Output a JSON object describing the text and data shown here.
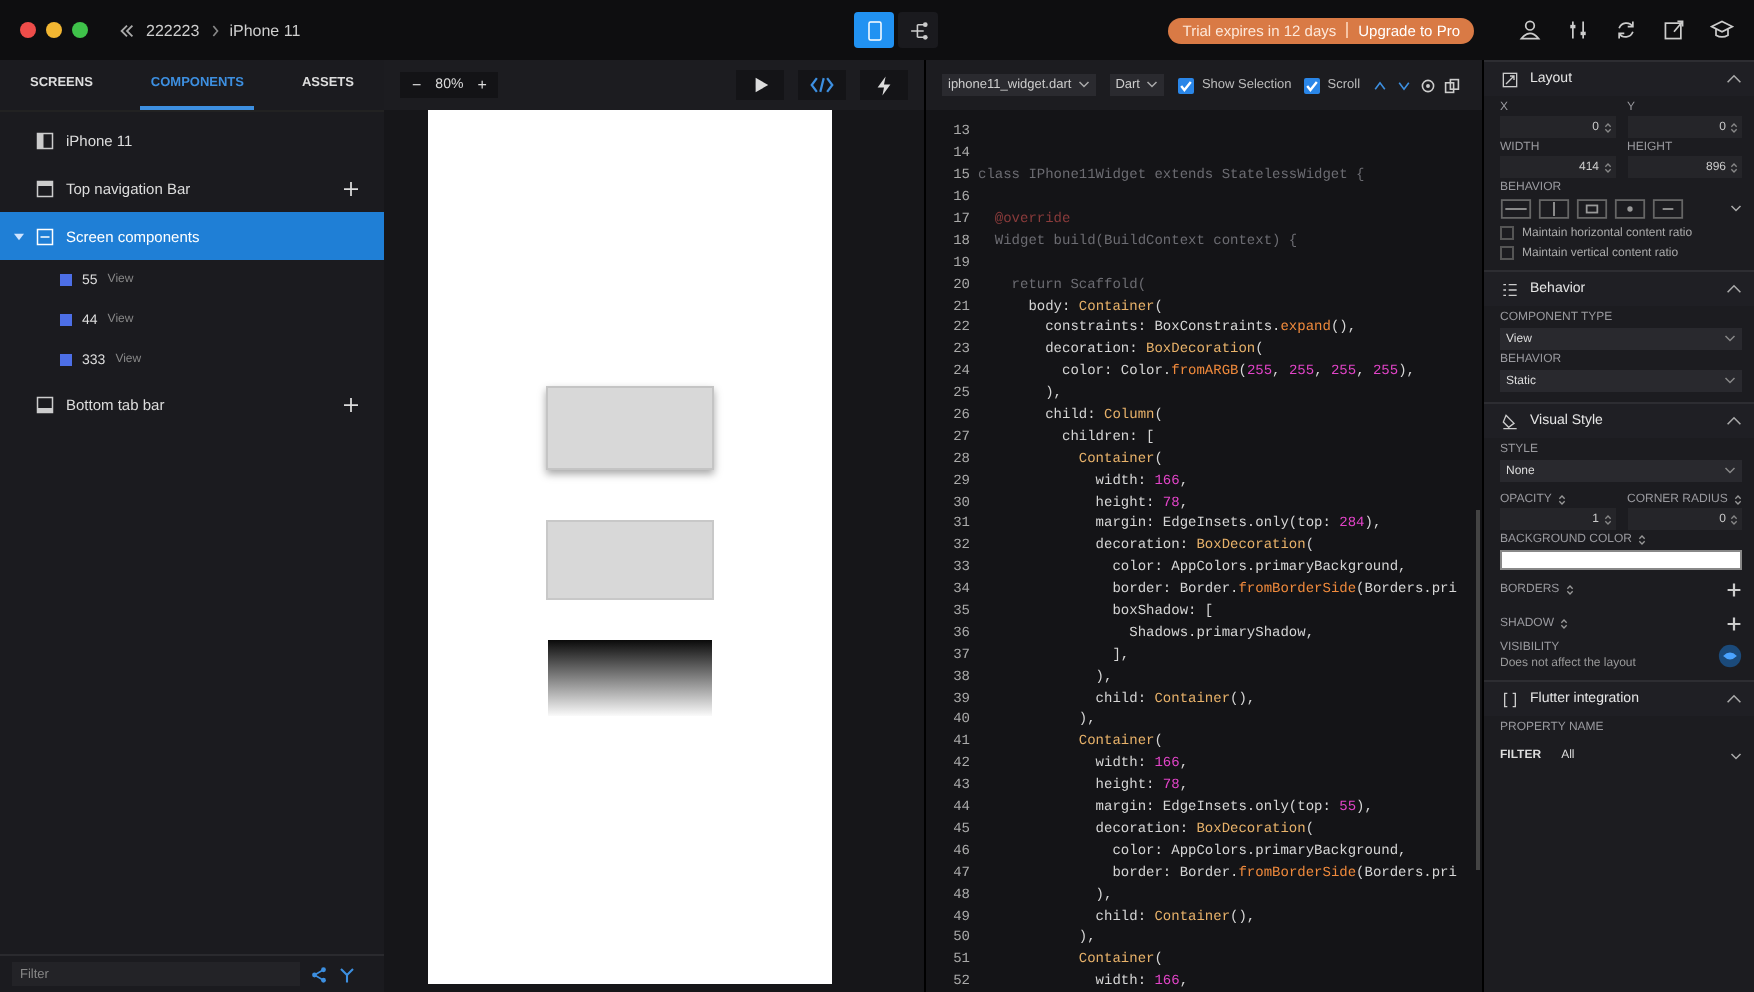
{
  "window": {
    "breadcrumb": [
      "222223",
      "iPhone 11"
    ]
  },
  "view_toggles": [
    {
      "kind": "device",
      "selected": true
    },
    {
      "kind": "tree",
      "selected": false
    }
  ],
  "trial": {
    "notice": "Trial expires in 12 days",
    "link": "Upgrade to Pro"
  },
  "sidebar": {
    "tabs": [
      {
        "label": "SCREENS",
        "selected": false
      },
      {
        "label": "COMPONENTS",
        "selected": true
      },
      {
        "label": "ASSETS",
        "selected": false
      }
    ],
    "tree": [
      {
        "kind": "screen",
        "label": "iPhone 11",
        "selected": false,
        "add": false
      },
      {
        "kind": "top-bar",
        "label": "Top navigation Bar",
        "selected": false,
        "add": true
      },
      {
        "kind": "group",
        "label": "Screen components",
        "selected": true,
        "add": false,
        "expanded": true,
        "children": [
          {
            "label": "55",
            "type": "View",
            "selected": false
          },
          {
            "label": "44",
            "type": "View",
            "selected": false
          },
          {
            "label": "333",
            "type": "View",
            "selected": false
          }
        ]
      },
      {
        "kind": "bottom-bar",
        "label": "Bottom tab bar",
        "selected": false,
        "add": true
      }
    ],
    "filter": {
      "placeholder": "Filter"
    }
  },
  "canvas": {
    "zoom_out": "−",
    "zoom": "80%",
    "zoom_in": "+",
    "tools": [
      {
        "kind": "play",
        "selected": false
      },
      {
        "kind": "code",
        "selected": true
      },
      {
        "kind": "bolt",
        "selected": false
      }
    ],
    "blocks": [
      {
        "kind": "shadow"
      },
      {
        "kind": "flat"
      },
      {
        "kind": "gradient"
      }
    ]
  },
  "code": {
    "file": "iphone11_widget.dart",
    "language": "Dart",
    "options": [
      {
        "label": "Show Selection",
        "checked": true
      },
      {
        "label": "Scroll",
        "checked": true
      }
    ],
    "lines": [
      {
        "n": "13"
      },
      {
        "n": "14"
      },
      {
        "n": "15",
        "tokens": [
          {
            "t": "class IPhone11Widget extends StatelessWidget {",
            "kind": "dim"
          }
        ]
      },
      {
        "n": "16"
      },
      {
        "n": "17",
        "tokens": [
          {
            "t": "  @override",
            "kind": "dimkw"
          }
        ]
      },
      {
        "n": "18",
        "tokens": [
          {
            "t": "  Widget build(BuildContext context) {",
            "kind": "dim"
          }
        ]
      },
      {
        "n": "19"
      },
      {
        "n": "20",
        "tokens": [
          {
            "t": "    return Scaffold(",
            "kind": "dim"
          }
        ]
      },
      {
        "n": "21",
        "tokens": [
          {
            "t": "      body: ",
            "kind": "p"
          },
          {
            "t": "Container",
            "kind": "type"
          },
          {
            "t": "(",
            "kind": "p"
          }
        ]
      },
      {
        "n": "22",
        "tokens": [
          {
            "t": "        constraints: BoxConstraints.",
            "kind": "p"
          },
          {
            "t": "expand",
            "kind": "fn"
          },
          {
            "t": "(),",
            "kind": "p"
          }
        ]
      },
      {
        "n": "23",
        "tokens": [
          {
            "t": "        decoration: ",
            "kind": "p"
          },
          {
            "t": "BoxDecoration",
            "kind": "type"
          },
          {
            "t": "(",
            "kind": "p"
          }
        ]
      },
      {
        "n": "24",
        "tokens": [
          {
            "t": "          color: Color.",
            "kind": "p"
          },
          {
            "t": "fromARGB",
            "kind": "fn"
          },
          {
            "t": "(",
            "kind": "p"
          },
          {
            "t": "255",
            "kind": "num"
          },
          {
            "t": ", ",
            "kind": "p"
          },
          {
            "t": "255",
            "kind": "num"
          },
          {
            "t": ", ",
            "kind": "p"
          },
          {
            "t": "255",
            "kind": "num"
          },
          {
            "t": ", ",
            "kind": "p"
          },
          {
            "t": "255",
            "kind": "num"
          },
          {
            "t": "),",
            "kind": "p"
          }
        ]
      },
      {
        "n": "25",
        "tokens": [
          {
            "t": "        ),",
            "kind": "p"
          }
        ]
      },
      {
        "n": "26",
        "tokens": [
          {
            "t": "        child: ",
            "kind": "p"
          },
          {
            "t": "Column",
            "kind": "type"
          },
          {
            "t": "(",
            "kind": "p"
          }
        ]
      },
      {
        "n": "27",
        "tokens": [
          {
            "t": "          children: [",
            "kind": "p"
          }
        ]
      },
      {
        "n": "28",
        "tokens": [
          {
            "t": "            Container",
            "kind": "type"
          },
          {
            "t": "(",
            "kind": "p"
          }
        ]
      },
      {
        "n": "29",
        "tokens": [
          {
            "t": "              width: ",
            "kind": "p"
          },
          {
            "t": "166",
            "kind": "num"
          },
          {
            "t": ",",
            "kind": "p"
          }
        ]
      },
      {
        "n": "30",
        "tokens": [
          {
            "t": "              height: ",
            "kind": "p"
          },
          {
            "t": "78",
            "kind": "num"
          },
          {
            "t": ",",
            "kind": "p"
          }
        ]
      },
      {
        "n": "31",
        "tokens": [
          {
            "t": "              margin: EdgeInsets.only(top: ",
            "kind": "p"
          },
          {
            "t": "284",
            "kind": "num"
          },
          {
            "t": "),",
            "kind": "p"
          }
        ]
      },
      {
        "n": "32",
        "tokens": [
          {
            "t": "              decoration: ",
            "kind": "p"
          },
          {
            "t": "BoxDecoration",
            "kind": "type"
          },
          {
            "t": "(",
            "kind": "p"
          }
        ]
      },
      {
        "n": "33",
        "tokens": [
          {
            "t": "                color: AppColors.primaryBackground,",
            "kind": "p"
          }
        ]
      },
      {
        "n": "34",
        "tokens": [
          {
            "t": "                border: Border.",
            "kind": "p"
          },
          {
            "t": "fromBorderSide",
            "kind": "fn"
          },
          {
            "t": "(Borders.pri",
            "kind": "p"
          }
        ]
      },
      {
        "n": "35",
        "tokens": [
          {
            "t": "                boxShadow: [",
            "kind": "p"
          }
        ]
      },
      {
        "n": "36",
        "tokens": [
          {
            "t": "                  Shadows.primaryShadow,",
            "kind": "p"
          }
        ]
      },
      {
        "n": "37",
        "tokens": [
          {
            "t": "                ],",
            "kind": "p"
          }
        ]
      },
      {
        "n": "38",
        "tokens": [
          {
            "t": "              ),",
            "kind": "p"
          }
        ]
      },
      {
        "n": "39",
        "tokens": [
          {
            "t": "              child: ",
            "kind": "p"
          },
          {
            "t": "Container",
            "kind": "type"
          },
          {
            "t": "(),",
            "kind": "p"
          }
        ]
      },
      {
        "n": "40",
        "tokens": [
          {
            "t": "            ),",
            "kind": "p"
          }
        ]
      },
      {
        "n": "41",
        "tokens": [
          {
            "t": "            Container",
            "kind": "type"
          },
          {
            "t": "(",
            "kind": "p"
          }
        ]
      },
      {
        "n": "42",
        "tokens": [
          {
            "t": "              width: ",
            "kind": "p"
          },
          {
            "t": "166",
            "kind": "num"
          },
          {
            "t": ",",
            "kind": "p"
          }
        ]
      },
      {
        "n": "43",
        "tokens": [
          {
            "t": "              height: ",
            "kind": "p"
          },
          {
            "t": "78",
            "kind": "num"
          },
          {
            "t": ",",
            "kind": "p"
          }
        ]
      },
      {
        "n": "44",
        "tokens": [
          {
            "t": "              margin: EdgeInsets.only(top: ",
            "kind": "p"
          },
          {
            "t": "55",
            "kind": "num"
          },
          {
            "t": "),",
            "kind": "p"
          }
        ]
      },
      {
        "n": "45",
        "tokens": [
          {
            "t": "              decoration: ",
            "kind": "p"
          },
          {
            "t": "BoxDecoration",
            "kind": "type"
          },
          {
            "t": "(",
            "kind": "p"
          }
        ]
      },
      {
        "n": "46",
        "tokens": [
          {
            "t": "                color: AppColors.primaryBackground,",
            "kind": "p"
          }
        ]
      },
      {
        "n": "47",
        "tokens": [
          {
            "t": "                border: Border.",
            "kind": "p"
          },
          {
            "t": "fromBorderSide",
            "kind": "fn"
          },
          {
            "t": "(Borders.pri",
            "kind": "p"
          }
        ]
      },
      {
        "n": "48",
        "tokens": [
          {
            "t": "              ),",
            "kind": "p"
          }
        ]
      },
      {
        "n": "49",
        "tokens": [
          {
            "t": "              child: ",
            "kind": "p"
          },
          {
            "t": "Container",
            "kind": "type"
          },
          {
            "t": "(),",
            "kind": "p"
          }
        ]
      },
      {
        "n": "50",
        "tokens": [
          {
            "t": "            ),",
            "kind": "p"
          }
        ]
      },
      {
        "n": "51",
        "tokens": [
          {
            "t": "            Container",
            "kind": "type"
          },
          {
            "t": "(",
            "kind": "p"
          }
        ]
      },
      {
        "n": "52",
        "tokens": [
          {
            "t": "              width: ",
            "kind": "p"
          },
          {
            "t": "166",
            "kind": "num"
          },
          {
            "t": ",",
            "kind": "p"
          }
        ]
      }
    ]
  },
  "inspector": {
    "layout": {
      "title": "Layout",
      "expanded": true,
      "fields": [
        {
          "label": "X",
          "value": "0"
        },
        {
          "label": "Y",
          "value": "0"
        },
        {
          "label": "WIDTH",
          "value": "414"
        },
        {
          "label": "HEIGHT",
          "value": "896"
        }
      ],
      "behavior_label": "BEHAVIOR",
      "ratios": [
        {
          "label": "Maintain horizontal content ratio",
          "checked": false
        },
        {
          "label": "Maintain vertical content ratio",
          "checked": false
        }
      ]
    },
    "behavior": {
      "title": "Behavior",
      "expanded": true,
      "selects": [
        {
          "label": "COMPONENT TYPE",
          "value": "View"
        },
        {
          "label": "BEHAVIOR",
          "value": "Static"
        }
      ]
    },
    "visual_style": {
      "title": "Visual Style",
      "expanded": true,
      "style": {
        "label": "STYLE",
        "value": "None"
      },
      "numbers": [
        {
          "label": "OPACITY",
          "value": "1"
        },
        {
          "label": "CORNER RADIUS",
          "value": "0"
        }
      ],
      "background": {
        "label": "BACKGROUND COLOR",
        "color": "#ffffff"
      },
      "lists": [
        {
          "label": "BORDERS"
        },
        {
          "label": "SHADOW"
        }
      ],
      "visibility": {
        "label": "VISIBILITY",
        "note": "Does not affect the layout",
        "visible": true
      }
    },
    "flutter": {
      "title": "Flutter integration",
      "expanded": true,
      "property_label": "PROPERTY NAME",
      "filter": {
        "label": "FILTER",
        "value": "All"
      }
    }
  }
}
